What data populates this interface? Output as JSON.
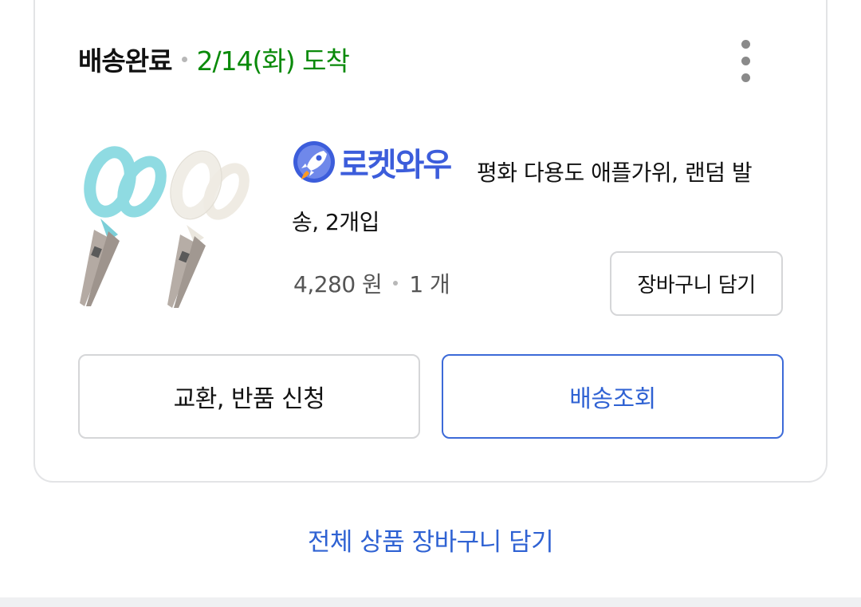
{
  "order": {
    "status": "배송완료",
    "arrival": "2/14(화) 도착"
  },
  "product": {
    "badge_label": "로켓와우",
    "name": "평화 다용도 애플가위, 랜덤 발송, 2개입",
    "price": "4,280 원",
    "quantity": "1 개",
    "add_to_cart_label": "장바구니 담기"
  },
  "actions": {
    "exchange_return_label": "교환, 반품 신청",
    "tracking_label": "배송조회"
  },
  "footer": {
    "add_all_to_cart_label": "전체 상품 장바구니 담기"
  },
  "icons": {
    "more": "more-vertical-icon",
    "rocket": "rocket-icon"
  },
  "colors": {
    "arrival": "#0a8a0a",
    "badge": "#3c5ddb",
    "link": "#2f62d3",
    "tracking_border": "#3c6ad8"
  }
}
